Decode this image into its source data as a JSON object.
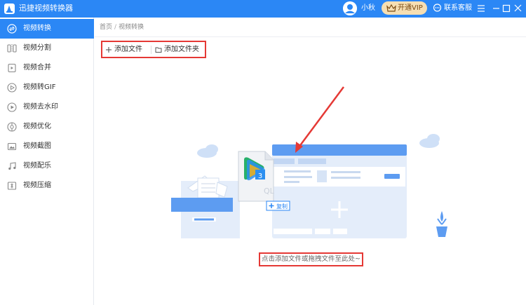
{
  "app": {
    "title": "迅捷视频转换器"
  },
  "titlebar": {
    "username": "小秋",
    "vip_label": "开通VIP",
    "service_label": "联系客服"
  },
  "sidebar": {
    "items": [
      {
        "label": "视频转换",
        "icon": "convert-icon",
        "active": true
      },
      {
        "label": "视频分割",
        "icon": "split-icon"
      },
      {
        "label": "视频合并",
        "icon": "merge-icon"
      },
      {
        "label": "视频转GIF",
        "icon": "gif-icon"
      },
      {
        "label": "视频去水印",
        "icon": "watermark-icon"
      },
      {
        "label": "视频优化",
        "icon": "optimize-icon"
      },
      {
        "label": "视频截图",
        "icon": "screenshot-icon"
      },
      {
        "label": "视频配乐",
        "icon": "music-icon"
      },
      {
        "label": "视频压缩",
        "icon": "compress-icon"
      }
    ]
  },
  "breadcrumb": {
    "home": "首页",
    "separator": "/",
    "current": "视频转换"
  },
  "toolbar": {
    "add_file": "添加文件",
    "add_folder": "添加文件夹"
  },
  "dropzone": {
    "copy_badge": "复制",
    "file_badge": "3",
    "hint": "点击添加文件或拖拽文件至此处~"
  },
  "colors": {
    "primary": "#2b87f5",
    "highlight": "#e53935",
    "vip_bg": "#f6dfb3"
  }
}
